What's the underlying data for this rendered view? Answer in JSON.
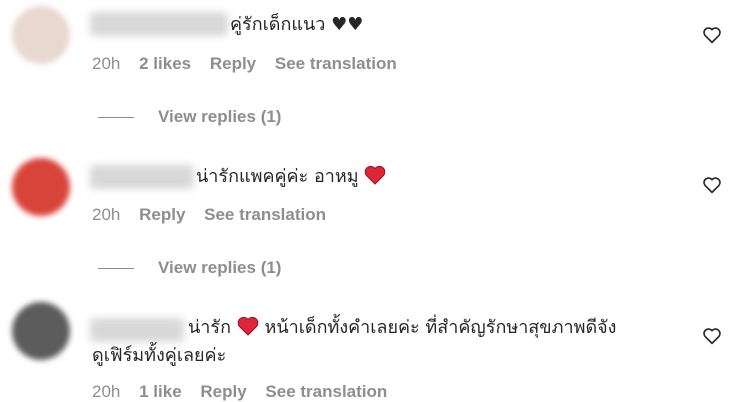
{
  "comments": [
    {
      "text_before": "คู่รักเด็กแนว ♥♥",
      "text_after": "",
      "meta": {
        "time": "20h",
        "likes": "2 likes",
        "reply": "Reply",
        "translate": "See translation"
      },
      "view_replies": "View replies (1)",
      "avatar_color": "#e8d8cf"
    },
    {
      "text_before": "น่ารักแพคคู่ค่ะ อาหมู",
      "text_after": "",
      "meta": {
        "time": "20h",
        "reply": "Reply",
        "translate": "See translation"
      },
      "view_replies": "View replies (1)",
      "avatar_color": "#d9443a"
    },
    {
      "text_before": "น่ารัก",
      "text_after": " หน้าเด็กทั้งคำเลยค่ะ ที่สำคัญรักษาสุขภาพดีจัง",
      "text_line2": "ดูเฟิร์มทั้งคู่เลยค่ะ",
      "meta": {
        "time": "20h",
        "likes": "1 like",
        "reply": "Reply",
        "translate": "See translation"
      },
      "avatar_color": "#5c5c5c"
    }
  ],
  "icons": {
    "like": "heart-outline-icon",
    "emoji": "red-heart-emoji-icon"
  },
  "colors": {
    "text": "#262626",
    "meta": "#8e8e8e",
    "emoji_red": "#e0243a"
  }
}
